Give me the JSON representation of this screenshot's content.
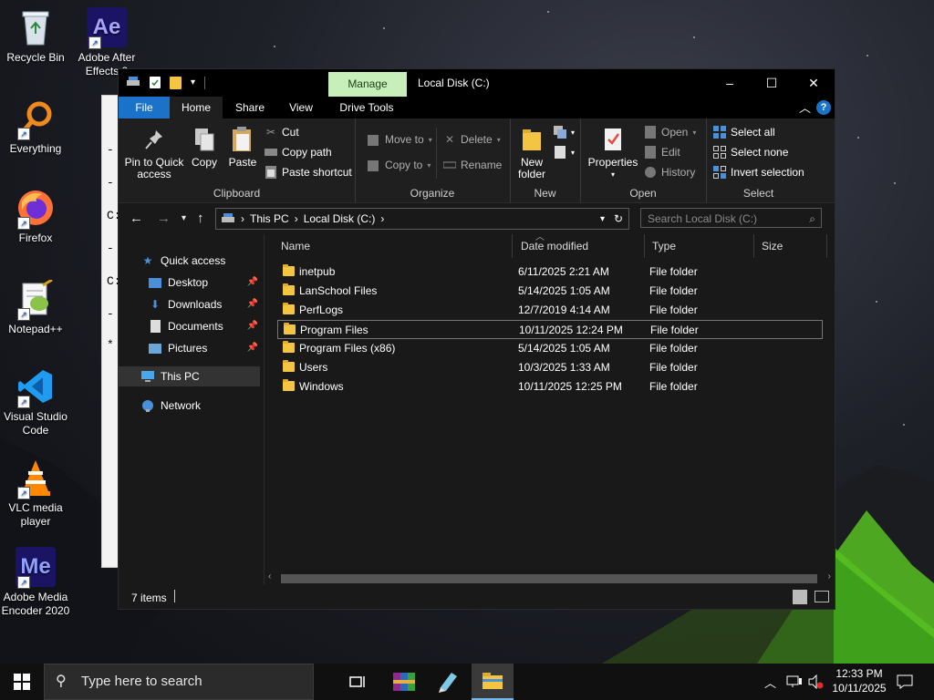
{
  "desktop": {
    "icons": [
      {
        "label": "Recycle Bin"
      },
      {
        "label": "Adobe After Effects 2"
      },
      {
        "label": "Everything"
      },
      {
        "label": "Firefox"
      },
      {
        "label": "Notepad++"
      },
      {
        "label": "Visual Studio Code"
      },
      {
        "label": "VLC media player"
      },
      {
        "label": "Adobe Media Encoder 2020"
      }
    ],
    "ae_text": "Ae",
    "me_text": "Me"
  },
  "background_doc_lines": [
    "-",
    "-",
    "C:",
    "-",
    "C:",
    "-",
    "*"
  ],
  "window": {
    "title": "Local Disk (C:)",
    "manage_tab": "Manage",
    "tabs": [
      "File",
      "Home",
      "Share",
      "View",
      "Drive Tools"
    ],
    "help": "?",
    "ribbon": {
      "clipboard": {
        "pin": "Pin to Quick access",
        "copy": "Copy",
        "paste": "Paste",
        "cut": "Cut",
        "copy_path": "Copy path",
        "paste_shortcut": "Paste shortcut",
        "label": "Clipboard"
      },
      "organize": {
        "move_to": "Move to",
        "copy_to": "Copy to",
        "delete": "Delete",
        "rename": "Rename",
        "label": "Organize"
      },
      "new": {
        "new_folder": "New folder",
        "label": "New"
      },
      "open": {
        "properties": "Properties",
        "open": "Open",
        "edit": "Edit",
        "history": "History",
        "label": "Open"
      },
      "select": {
        "select_all": "Select all",
        "select_none": "Select none",
        "invert_selection": "Invert selection",
        "label": "Select"
      }
    },
    "address": {
      "segments": [
        "This PC",
        "Local Disk (C:)"
      ],
      "search_placeholder": "Search Local Disk (C:)"
    },
    "nav": [
      {
        "label": "Quick access",
        "pinned": false
      },
      {
        "label": "Desktop",
        "pinned": true
      },
      {
        "label": "Downloads",
        "pinned": true
      },
      {
        "label": "Documents",
        "pinned": true
      },
      {
        "label": "Pictures",
        "pinned": true
      },
      {
        "label": "This PC",
        "pinned": false
      },
      {
        "label": "Network",
        "pinned": false
      }
    ],
    "columns": [
      "Name",
      "Date modified",
      "Type",
      "Size"
    ],
    "files": [
      {
        "name": "inetpub",
        "date": "6/11/2025 2:21 AM",
        "type": "File folder"
      },
      {
        "name": "LanSchool Files",
        "date": "5/14/2025 1:05 AM",
        "type": "File folder"
      },
      {
        "name": "PerfLogs",
        "date": "12/7/2019 4:14 AM",
        "type": "File folder"
      },
      {
        "name": "Program Files",
        "date": "10/11/2025 12:24 PM",
        "type": "File folder"
      },
      {
        "name": "Program Files (x86)",
        "date": "5/14/2025 1:05 AM",
        "type": "File folder"
      },
      {
        "name": "Users",
        "date": "10/3/2025 1:33 AM",
        "type": "File folder"
      },
      {
        "name": "Windows",
        "date": "10/11/2025 12:25 PM",
        "type": "File folder"
      }
    ],
    "selected_file": "Program Files",
    "status": "7 items"
  },
  "taskbar": {
    "search_placeholder": "Type here to search",
    "time": "12:33 PM",
    "date": "10/11/2025"
  },
  "colors": {
    "accent": "#1a73c8",
    "manage_tab": "#c6efb9",
    "folder": "#f4c542"
  }
}
